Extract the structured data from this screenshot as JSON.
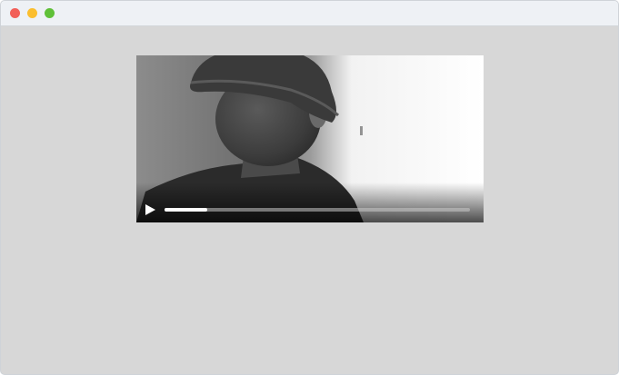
{
  "window": {
    "traffic_lights": [
      {
        "name": "close",
        "color": "#f25f58"
      },
      {
        "name": "minimize",
        "color": "#fbbe2e"
      },
      {
        "name": "maximize",
        "color": "#5fc038"
      }
    ]
  },
  "video_player": {
    "play_icon": "play-icon",
    "progress_fraction": 0.14,
    "colors": {
      "progress_fill": "#ffffff",
      "progress_track": "#bdbdbd",
      "controls_gradient": "#000000"
    }
  }
}
